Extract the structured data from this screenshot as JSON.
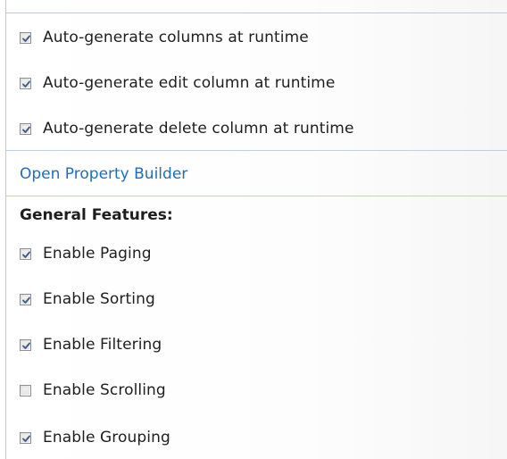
{
  "runtime_options": [
    {
      "label": "Auto-generate columns at runtime",
      "checked": true
    },
    {
      "label": "Auto-generate edit column at runtime",
      "checked": true
    },
    {
      "label": "Auto-generate delete column at runtime",
      "checked": true
    }
  ],
  "property_builder_link": "Open Property Builder",
  "general_features": {
    "heading": "General Features:",
    "items": [
      {
        "label": "Enable Paging",
        "checked": true
      },
      {
        "label": "Enable Sorting",
        "checked": true
      },
      {
        "label": "Enable Filtering",
        "checked": true
      },
      {
        "label": "Enable Scrolling",
        "checked": false
      },
      {
        "label": "Enable Grouping",
        "checked": true
      }
    ]
  },
  "colors": {
    "link": "#1e6fb8",
    "text": "#1e1e1e",
    "checkmark": "#3c5a84",
    "separator": "#bcd0e6"
  }
}
